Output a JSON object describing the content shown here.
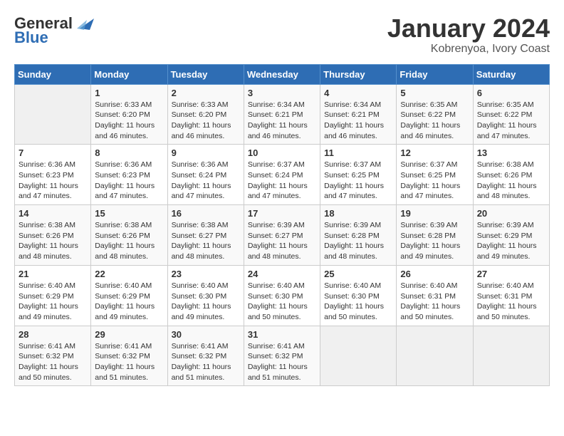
{
  "logo": {
    "line1": "General",
    "line2": "Blue"
  },
  "title": "January 2024",
  "subtitle": "Kobrenyoa, Ivory Coast",
  "days_of_week": [
    "Sunday",
    "Monday",
    "Tuesday",
    "Wednesday",
    "Thursday",
    "Friday",
    "Saturday"
  ],
  "weeks": [
    [
      {
        "day": "",
        "info": ""
      },
      {
        "day": "1",
        "info": "Sunrise: 6:33 AM\nSunset: 6:20 PM\nDaylight: 11 hours and 46 minutes."
      },
      {
        "day": "2",
        "info": "Sunrise: 6:33 AM\nSunset: 6:20 PM\nDaylight: 11 hours and 46 minutes."
      },
      {
        "day": "3",
        "info": "Sunrise: 6:34 AM\nSunset: 6:21 PM\nDaylight: 11 hours and 46 minutes."
      },
      {
        "day": "4",
        "info": "Sunrise: 6:34 AM\nSunset: 6:21 PM\nDaylight: 11 hours and 46 minutes."
      },
      {
        "day": "5",
        "info": "Sunrise: 6:35 AM\nSunset: 6:22 PM\nDaylight: 11 hours and 46 minutes."
      },
      {
        "day": "6",
        "info": "Sunrise: 6:35 AM\nSunset: 6:22 PM\nDaylight: 11 hours and 47 minutes."
      }
    ],
    [
      {
        "day": "7",
        "info": "Sunrise: 6:36 AM\nSunset: 6:23 PM\nDaylight: 11 hours and 47 minutes."
      },
      {
        "day": "8",
        "info": "Sunrise: 6:36 AM\nSunset: 6:23 PM\nDaylight: 11 hours and 47 minutes."
      },
      {
        "day": "9",
        "info": "Sunrise: 6:36 AM\nSunset: 6:24 PM\nDaylight: 11 hours and 47 minutes."
      },
      {
        "day": "10",
        "info": "Sunrise: 6:37 AM\nSunset: 6:24 PM\nDaylight: 11 hours and 47 minutes."
      },
      {
        "day": "11",
        "info": "Sunrise: 6:37 AM\nSunset: 6:25 PM\nDaylight: 11 hours and 47 minutes."
      },
      {
        "day": "12",
        "info": "Sunrise: 6:37 AM\nSunset: 6:25 PM\nDaylight: 11 hours and 47 minutes."
      },
      {
        "day": "13",
        "info": "Sunrise: 6:38 AM\nSunset: 6:26 PM\nDaylight: 11 hours and 48 minutes."
      }
    ],
    [
      {
        "day": "14",
        "info": "Sunrise: 6:38 AM\nSunset: 6:26 PM\nDaylight: 11 hours and 48 minutes."
      },
      {
        "day": "15",
        "info": "Sunrise: 6:38 AM\nSunset: 6:26 PM\nDaylight: 11 hours and 48 minutes."
      },
      {
        "day": "16",
        "info": "Sunrise: 6:38 AM\nSunset: 6:27 PM\nDaylight: 11 hours and 48 minutes."
      },
      {
        "day": "17",
        "info": "Sunrise: 6:39 AM\nSunset: 6:27 PM\nDaylight: 11 hours and 48 minutes."
      },
      {
        "day": "18",
        "info": "Sunrise: 6:39 AM\nSunset: 6:28 PM\nDaylight: 11 hours and 48 minutes."
      },
      {
        "day": "19",
        "info": "Sunrise: 6:39 AM\nSunset: 6:28 PM\nDaylight: 11 hours and 49 minutes."
      },
      {
        "day": "20",
        "info": "Sunrise: 6:39 AM\nSunset: 6:29 PM\nDaylight: 11 hours and 49 minutes."
      }
    ],
    [
      {
        "day": "21",
        "info": "Sunrise: 6:40 AM\nSunset: 6:29 PM\nDaylight: 11 hours and 49 minutes."
      },
      {
        "day": "22",
        "info": "Sunrise: 6:40 AM\nSunset: 6:29 PM\nDaylight: 11 hours and 49 minutes."
      },
      {
        "day": "23",
        "info": "Sunrise: 6:40 AM\nSunset: 6:30 PM\nDaylight: 11 hours and 49 minutes."
      },
      {
        "day": "24",
        "info": "Sunrise: 6:40 AM\nSunset: 6:30 PM\nDaylight: 11 hours and 50 minutes."
      },
      {
        "day": "25",
        "info": "Sunrise: 6:40 AM\nSunset: 6:30 PM\nDaylight: 11 hours and 50 minutes."
      },
      {
        "day": "26",
        "info": "Sunrise: 6:40 AM\nSunset: 6:31 PM\nDaylight: 11 hours and 50 minutes."
      },
      {
        "day": "27",
        "info": "Sunrise: 6:40 AM\nSunset: 6:31 PM\nDaylight: 11 hours and 50 minutes."
      }
    ],
    [
      {
        "day": "28",
        "info": "Sunrise: 6:41 AM\nSunset: 6:32 PM\nDaylight: 11 hours and 50 minutes."
      },
      {
        "day": "29",
        "info": "Sunrise: 6:41 AM\nSunset: 6:32 PM\nDaylight: 11 hours and 51 minutes."
      },
      {
        "day": "30",
        "info": "Sunrise: 6:41 AM\nSunset: 6:32 PM\nDaylight: 11 hours and 51 minutes."
      },
      {
        "day": "31",
        "info": "Sunrise: 6:41 AM\nSunset: 6:32 PM\nDaylight: 11 hours and 51 minutes."
      },
      {
        "day": "",
        "info": ""
      },
      {
        "day": "",
        "info": ""
      },
      {
        "day": "",
        "info": ""
      }
    ]
  ]
}
